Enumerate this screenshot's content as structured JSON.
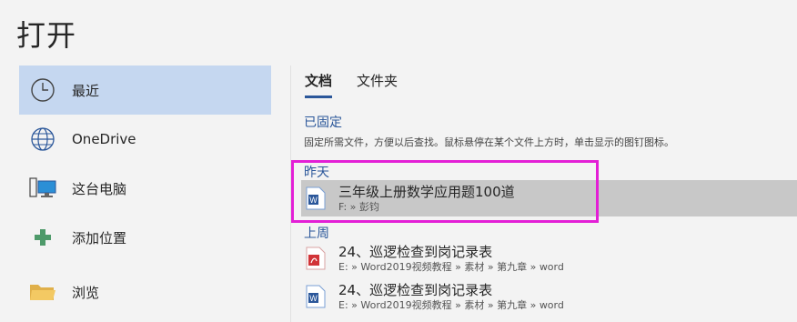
{
  "page": {
    "title": "打开"
  },
  "nav": {
    "items": [
      {
        "label": "最近",
        "icon": "clock-icon"
      },
      {
        "label": "OneDrive",
        "icon": "globe-icon"
      },
      {
        "label": "这台电脑",
        "icon": "computer-icon"
      },
      {
        "label": "添加位置",
        "icon": "plus-icon"
      },
      {
        "label": "浏览",
        "icon": "folder-icon"
      }
    ]
  },
  "tabs": [
    {
      "label": "文档"
    },
    {
      "label": "文件夹"
    }
  ],
  "pinned": {
    "heading": "已固定",
    "description": "固定所需文件，方便以后查找。鼠标悬停在某个文件上方时，单击显示的图钉图标。"
  },
  "yesterday": {
    "heading": "昨天",
    "files": [
      {
        "name": "三年级上册数学应用题100道",
        "path": "F: » 彭钧",
        "icon": "word-doc-icon"
      }
    ]
  },
  "last_week": {
    "heading": "上周",
    "files": [
      {
        "name": "24、巡逻检查到岗记录表",
        "path": "E: » Word2019视频教程 » 素材 » 第九章 » word",
        "icon": "pdf-doc-icon"
      },
      {
        "name": "24、巡逻检查到岗记录表",
        "path": "E: » Word2019视频教程 » 素材 » 第九章 » word",
        "icon": "word-doc-icon"
      }
    ]
  },
  "colors": {
    "accent": "#2b579a",
    "selected_bg": "#c5d7f0",
    "highlight_bg": "#c8c8c8",
    "annotation": "#e31fd6"
  }
}
